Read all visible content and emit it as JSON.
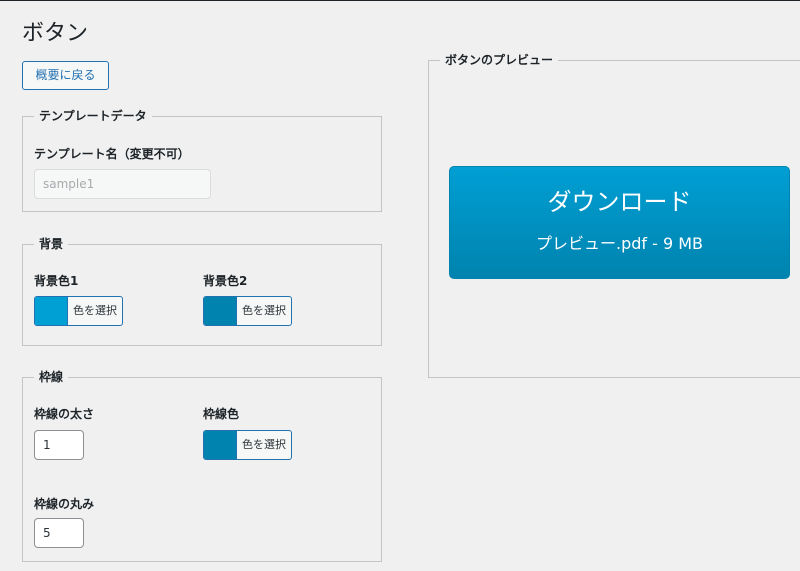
{
  "page": {
    "title": "ボタン"
  },
  "back_button": {
    "label": "概要に戻る"
  },
  "template_section": {
    "legend": "テンプレートデータ",
    "name_label": "テンプレート名（変更不可）",
    "name_value": "sample1"
  },
  "background_section": {
    "legend": "背景",
    "color1_label": "背景色1",
    "color1": "#009fd4",
    "color2_label": "背景色2",
    "color2": "#0083ae",
    "select_color_label": "色を選択"
  },
  "border_section": {
    "legend": "枠線",
    "width_label": "枠線の太さ",
    "width_value": "1",
    "color_label": "枠線色",
    "color": "#0083ae",
    "select_color_label": "色を選択",
    "radius_label": "枠線の丸み",
    "radius_value": "5"
  },
  "preview_section": {
    "legend": "ボタンのプレビュー",
    "button_main": "ダウンロード",
    "button_sub": "プレビュー.pdf - 9 MB"
  }
}
